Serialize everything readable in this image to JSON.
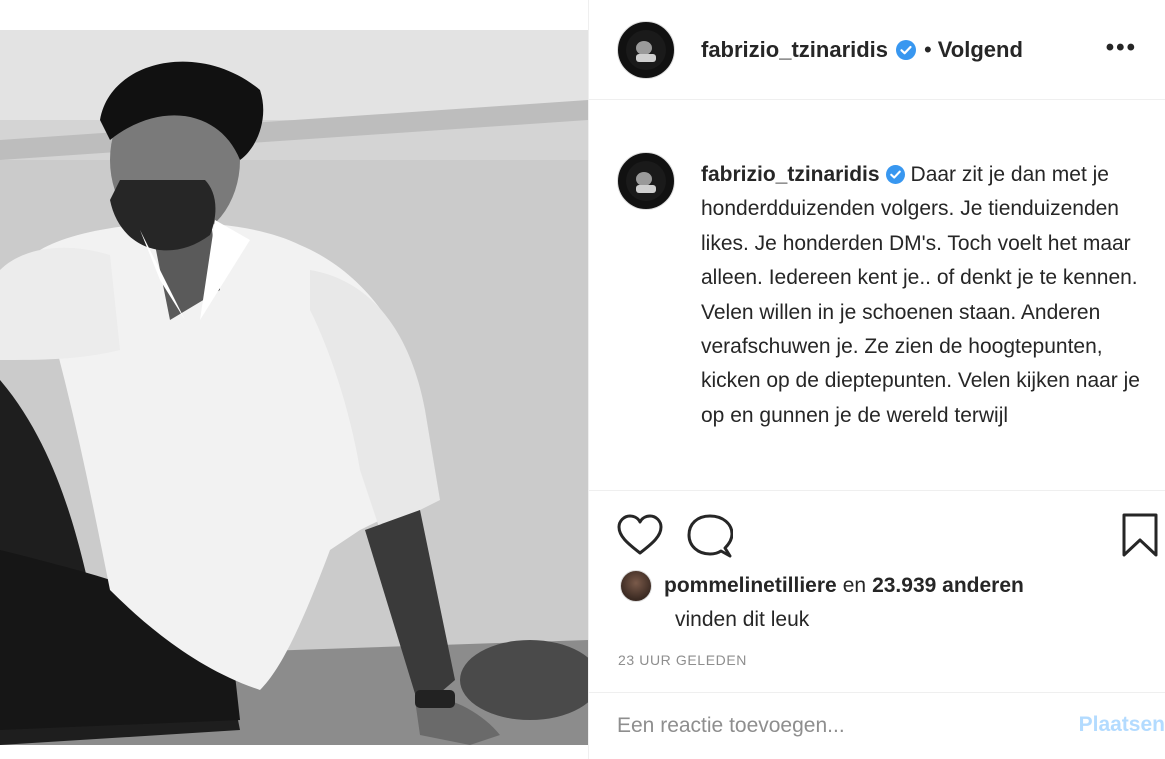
{
  "post": {
    "username": "fabrizio_tzinaridis",
    "follow_status": "Volgend",
    "dot": "•",
    "more_options": "•••",
    "caption": "Daar zit je dan met je honderdduizenden volgers. Je tienduizenden likes. Je honderden DM's. Toch voelt het maar alleen. Iedereen kent je.. of denkt je te kennen. Velen willen in je schoenen staan. Anderen verafschuwen je. Ze zien de hoogtepunten, kicken op de dieptepunten. Velen kijken naar je op en gunnen je de wereld terwijl",
    "likes": {
      "liker": "pommelinetilliere",
      "connector": "en",
      "count": "23.939 anderen",
      "suffix": "vinden dit leuk"
    },
    "timestamp": "23 UUR GELEDEN"
  },
  "comment": {
    "placeholder": "Een reactie toevoegen...",
    "post_label": "Plaatsen"
  },
  "colors": {
    "verified_badge": "#3897f0",
    "post_button_disabled": "#b3dbff",
    "secondary_text": "#8e8e8e",
    "primary_text": "#262626"
  },
  "icons": {
    "like": "heart-icon",
    "comment": "comment-icon",
    "save": "bookmark-icon",
    "verified": "verified-badge-icon"
  }
}
